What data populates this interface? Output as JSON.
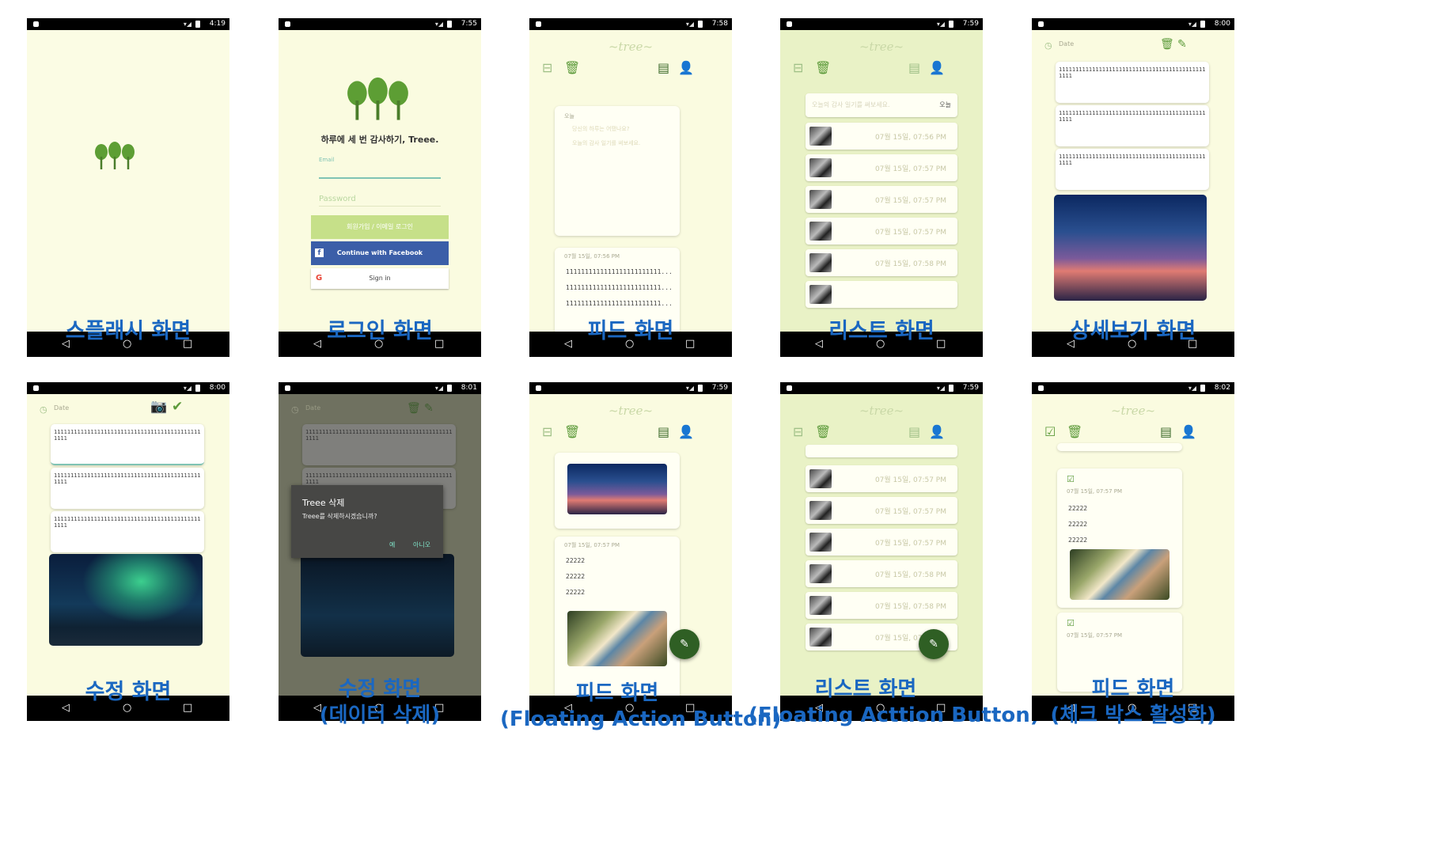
{
  "phones": [
    {
      "time": "4:19",
      "caption": "스플래시 화면"
    },
    {
      "time": "7:55",
      "caption": "로그인 화면"
    },
    {
      "time": "7:58",
      "caption": "피드 화면"
    },
    {
      "time": "7:59",
      "caption": "리스트 화면"
    },
    {
      "time": "8:00",
      "caption": "상세보기 화면"
    },
    {
      "time": "8:00",
      "caption": "수정 화면"
    },
    {
      "time": "8:01",
      "caption": "수정 화면",
      "caption_sub": "(데이터 삭제)"
    },
    {
      "time": "7:59",
      "caption": "피드 화면",
      "caption_sub": "(Floating Action Button)"
    },
    {
      "time": "7:59",
      "caption": "리스트 화면",
      "caption_sub": "(Floating Acttion Button)"
    },
    {
      "time": "8:02",
      "caption": "피드 화면",
      "caption_sub": "(체크 박스 활성화)"
    }
  ],
  "app_script_logo": "~tree~",
  "login": {
    "tagline": "하루에 세 번 감사하기, Treee.",
    "email_label": "Email",
    "password_placeholder": "Password",
    "signup_button": "회원가입 / 이메일 로그인",
    "facebook_button": "Continue with Facebook",
    "google_button": "Sign in"
  },
  "feed": {
    "compose_today": "오늘",
    "compose_prompt1": "당신의 하루는 어땠나요?",
    "compose_prompt2": "오늘의 감사 일기를 써보세요.",
    "entry_date1": "07월 15일, 07:56 PM",
    "entry_line": "1111111111111111111111111...",
    "entry_date2": "07월 15일, 07:57 PM",
    "entry_value": "22222"
  },
  "list": {
    "search_placeholder": "오늘의 감사 일기를 써보세요.",
    "today_chip": "오늘",
    "dates": [
      "07월 15일, 07:56 PM",
      "07월 15일, 07:57 PM",
      "07월 15일, 07:57 PM",
      "07월 15일, 07:57 PM",
      "07월 15일, 07:58 PM"
    ],
    "dates_fab": [
      "07월 15일, 07:57 PM",
      "07월 15일, 07:57 PM",
      "07월 15일, 07:57 PM",
      "07월 15일, 07:58 PM",
      "07월 15일, 07:58 PM",
      "07월 15일, 07:58 PM"
    ]
  },
  "detail": {
    "date_label": "Date",
    "memo_text": "111111111111111111111111111111111111111111111111"
  },
  "dialog": {
    "title": "Treee 삭제",
    "message": "Treee를 삭제하시겠습니까?",
    "yes": "예",
    "no": "아니오"
  },
  "colors": {
    "caption": "#1a67c1",
    "screen_bg": "#fafbe0",
    "accent_green": "#5c9a3a",
    "fab": "#2f5f24"
  }
}
